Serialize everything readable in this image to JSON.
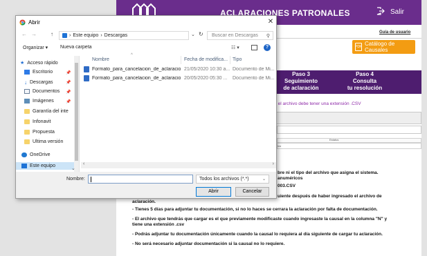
{
  "site": {
    "header_title": "ACLARACIONES PATRONALES",
    "exit_label": "Salir",
    "guide_link": "Guía de usuario",
    "catalog_button": "Catálogo de Causales",
    "steps": [
      {
        "line1": "Paso 3",
        "line2": "Seguimiento",
        "line3": "de aclaración"
      },
      {
        "line1": "Paso 4",
        "line2": "Consulta",
        "line3": "tu resolución"
      }
    ],
    "warning": "; el archivo debe tener una extensión .CSV",
    "tab_label": "rchivo",
    "table_header": "Estatus",
    "table_row": "ivo",
    "info_lines": [
      "bre ni el tipo del archivo que asigna el sistema.",
      "anuméricos",
      "003.CSV",
      "uiente después de haber ingresado el archivo de",
      "aclaración.",
      "- Tienes 5 días para adjuntar tu documentación, si no lo haces se cerrara la aclaración por falta de documentación.",
      "- El archivo que tendrás que cargar es el que previamente modificaste cuando ingresaste la causal en la columna \"N\" y",
      "tiene una extensión .csv",
      "- Podrás adjuntar tu documentación únicamente cuando la causal lo requiera al día siguiente de cargar tu aclaración.",
      "- No será necesario adjuntar documentación si la causal no lo requiere."
    ]
  },
  "dialog": {
    "title": "Abrir",
    "breadcrumb": [
      "Este equipo",
      "Descargas"
    ],
    "search_placeholder": "Buscar en Descargas",
    "toolbar": {
      "organize": "Organizar ▾",
      "new_folder": "Nueva carpeta"
    },
    "nav_items": [
      {
        "label": "Acceso rápido",
        "icon": "star-icon"
      },
      {
        "label": "Escritorio",
        "icon": "desktop-icon",
        "pinned": true
      },
      {
        "label": "Descargas",
        "icon": "download-icon",
        "pinned": true
      },
      {
        "label": "Documentos",
        "icon": "documents-icon",
        "pinned": true
      },
      {
        "label": "Imágenes",
        "icon": "pictures-icon",
        "pinned": true
      },
      {
        "label": "Garantía del inte",
        "icon": "folder-icon"
      },
      {
        "label": "Infonavit",
        "icon": "folder-icon"
      },
      {
        "label": "Propuesta",
        "icon": "folder-icon"
      },
      {
        "label": "Ultima versión",
        "icon": "folder-icon"
      },
      {
        "label": "OneDrive",
        "icon": "cloud-icon"
      },
      {
        "label": "Este equipo",
        "icon": "computer-icon",
        "selected": true
      }
    ],
    "columns": {
      "name": "Nombre",
      "date": "Fecha de modifica...",
      "type": "Tipo"
    },
    "files": [
      {
        "name": "Formato_para_cancelacion_de_aclaracio...",
        "date": "21/05/2020 10:30 a...",
        "type": "Documento de Mi..."
      },
      {
        "name": "Formato_para_cancelacion_de_aclaracio...",
        "date": "20/05/2020 05:30 ...",
        "type": "Documento de Mi..."
      }
    ],
    "filename_label": "Nombre:",
    "filename_value": "",
    "filetype_value": "Todos los archivos (*.*)",
    "open_button": "Abrir",
    "cancel_button": "Cancelar"
  },
  "colors": {
    "purple_header": "#6a2d8c",
    "purple_steps": "#4e1d6f",
    "orange_button": "#f39c12",
    "accent_blue": "#0078d7"
  }
}
